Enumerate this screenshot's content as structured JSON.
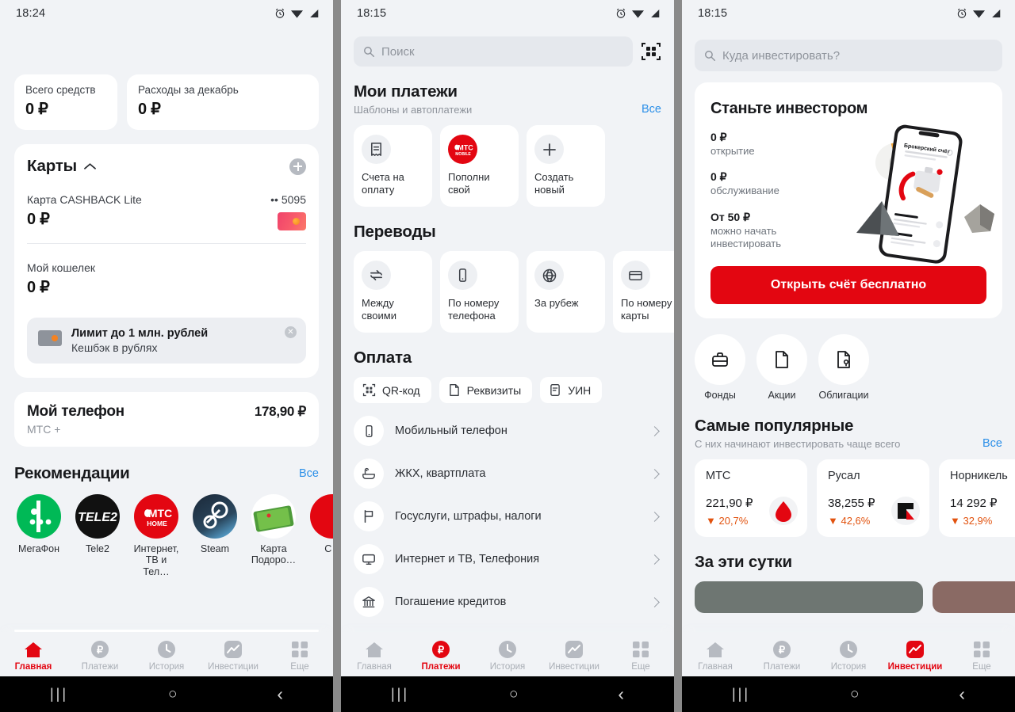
{
  "panels": {
    "home": {
      "status": {
        "time": "18:24",
        "icons": [
          "alarm-icon",
          "wifi-icon",
          "signal-icon"
        ]
      },
      "summary_tiles": [
        {
          "label": "Всего средств",
          "value": "0 ₽"
        },
        {
          "label": "Расходы за декабрь",
          "value": "0 ₽"
        }
      ],
      "cards_section": {
        "title": "Карты",
        "collapse_icon": "chevron-up-icon",
        "add_icon": "plus-icon",
        "cards": [
          {
            "name": "Карта CASHBACK Lite",
            "amount": "0 ₽",
            "mask": "•• 5095"
          },
          {
            "name": "Мой кошелек",
            "amount": "0 ₽"
          }
        ],
        "promo": {
          "title": "Лимит до 1 млн. рублей",
          "subtitle": "Кешбэк в рублях",
          "close": "✕"
        }
      },
      "phone_block": {
        "title": "Мой телефон",
        "amount": "178,90 ₽",
        "subtitle": "МТС +"
      },
      "recommendations": {
        "title": "Рекомендации",
        "all_label": "Все",
        "items": [
          {
            "label": "МегаФон"
          },
          {
            "label": "Tele2"
          },
          {
            "label": "Интернет, ТВ и Тел…"
          },
          {
            "label": "Steam"
          },
          {
            "label": "Карта Подоро…"
          },
          {
            "label": "С о"
          }
        ]
      },
      "nav": {
        "items": [
          {
            "label": "Главная",
            "icon": "home-icon",
            "active": true
          },
          {
            "label": "Платежи",
            "icon": "ruble-icon",
            "active": false
          },
          {
            "label": "История",
            "icon": "clock-icon",
            "active": false
          },
          {
            "label": "Инвестиции",
            "icon": "chart-icon",
            "active": false
          },
          {
            "label": "Еще",
            "icon": "grid-icon",
            "active": false
          }
        ]
      }
    },
    "payments": {
      "status": {
        "time": "18:15"
      },
      "search": {
        "placeholder": "Поиск",
        "icon": "search-icon",
        "qr_icon": "qr-scan-icon"
      },
      "my_payments": {
        "title": "Мои платежи",
        "subtitle": "Шаблоны и автоплатежи",
        "all_label": "Все",
        "tiles": [
          {
            "label": "Счета на оплату",
            "icon": "receipt-icon"
          },
          {
            "label": "Пополни свой",
            "icon": "mts-mobile-logo"
          },
          {
            "label": "Создать новый",
            "icon": "plus-icon"
          }
        ]
      },
      "transfers": {
        "title": "Переводы",
        "tiles": [
          {
            "label": "Между своими",
            "icon": "swap-icon"
          },
          {
            "label": "По номеру телефона",
            "icon": "mobile-icon"
          },
          {
            "label": "За рубеж",
            "icon": "globe-icon"
          },
          {
            "label": "По номеру карты",
            "icon": "card-icon"
          }
        ]
      },
      "pay": {
        "title": "Оплата",
        "chips": [
          {
            "label": "QR-код",
            "icon": "qr-icon"
          },
          {
            "label": "Реквизиты",
            "icon": "document-icon"
          },
          {
            "label": "УИН",
            "icon": "form-icon"
          }
        ],
        "list": [
          {
            "label": "Мобильный телефон",
            "icon": "mobile-icon"
          },
          {
            "label": "ЖКХ, квартплата",
            "icon": "bath-icon"
          },
          {
            "label": "Госуслуги, штрафы, налоги",
            "icon": "flag-icon"
          },
          {
            "label": "Интернет и ТВ, Телефония",
            "icon": "tv-icon"
          },
          {
            "label": "Погашение кредитов",
            "icon": "bank-icon"
          }
        ]
      },
      "nav": {
        "items": [
          {
            "label": "Главная",
            "icon": "home-icon",
            "active": false
          },
          {
            "label": "Платежи",
            "icon": "ruble-icon",
            "active": true
          },
          {
            "label": "История",
            "icon": "clock-icon",
            "active": false
          },
          {
            "label": "Инвестиции",
            "icon": "chart-icon",
            "active": false
          },
          {
            "label": "Еще",
            "icon": "grid-icon",
            "active": false
          }
        ]
      }
    },
    "investments": {
      "status": {
        "time": "18:15"
      },
      "search": {
        "placeholder": "Куда инвестировать?",
        "icon": "search-icon"
      },
      "banner": {
        "title": "Станьте инвестором",
        "facts": [
          {
            "value": "0 ₽",
            "label": "открытие"
          },
          {
            "value": "0 ₽",
            "label": "обслуживание"
          },
          {
            "value": "От 50 ₽",
            "label": "можно начать инвестировать"
          }
        ],
        "cta": "Открыть счёт бесплатно",
        "art_caption": "Брокерский счёт"
      },
      "categories": [
        {
          "label": "Фонды",
          "icon": "briefcase-icon"
        },
        {
          "label": "Акции",
          "icon": "document-icon"
        },
        {
          "label": "Облигации",
          "icon": "bond-icon"
        }
      ],
      "popular": {
        "title": "Самые популярные",
        "subtitle": "С них начинают инвестировать чаще всего",
        "all_label": "Все",
        "stocks": [
          {
            "name": "МТС",
            "price": "221,90 ₽",
            "change": "▼ 20,7%",
            "logo": "mts-egg-logo"
          },
          {
            "name": "Русал",
            "price": "38,255 ₽",
            "change": "▼ 42,6%",
            "logo": "rusal-logo"
          },
          {
            "name": "Норникель",
            "price": "14 292 ₽",
            "change": "▼ 32,9%",
            "logo": "nornickel-logo"
          }
        ]
      },
      "today": {
        "title": "За эти сутки"
      },
      "nav": {
        "items": [
          {
            "label": "Главная",
            "icon": "home-icon",
            "active": false
          },
          {
            "label": "Платежи",
            "icon": "ruble-icon",
            "active": false
          },
          {
            "label": "История",
            "icon": "clock-icon",
            "active": false
          },
          {
            "label": "Инвестиции",
            "icon": "chart-icon",
            "active": true
          },
          {
            "label": "Еще",
            "icon": "grid-icon",
            "active": false
          }
        ]
      }
    }
  },
  "system_navbar": {
    "recents": "|||",
    "home": "○",
    "back": "‹"
  },
  "colors": {
    "accent": "#e30611",
    "link": "#2b8fe8",
    "negative": "#e2530f",
    "bg": "#f1f3f6"
  }
}
